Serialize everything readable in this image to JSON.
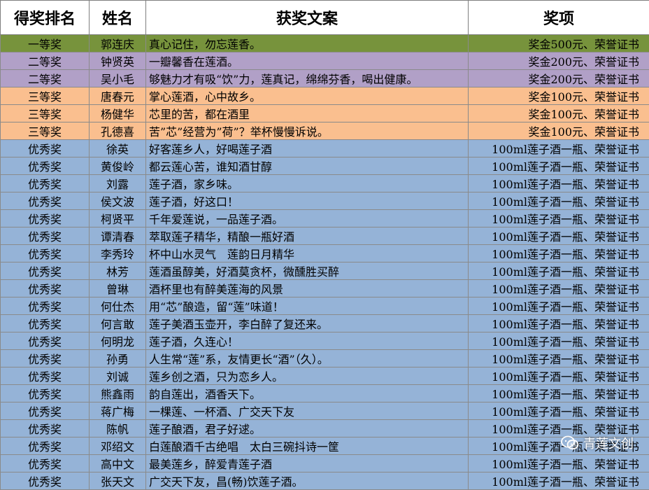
{
  "colors": {
    "first": "#77933c",
    "second": "#b1a0c7",
    "third": "#fabf8f",
    "merit": "#95b3d7"
  },
  "headers": [
    "得奖排名",
    "姓名",
    "获奖文案",
    "奖项"
  ],
  "rows": [
    {
      "tier": "first",
      "rank": "一等奖",
      "name": "郭连庆",
      "slogan": "真心记住，勿忘莲香。",
      "prize": "奖金500元、荣誉证书"
    },
    {
      "tier": "second",
      "rank": "二等奖",
      "name": "钟贤英",
      "slogan": "一瓣馨香在莲酒。",
      "prize": "奖金200元、荣誉证书"
    },
    {
      "tier": "second",
      "rank": "二等奖",
      "name": "吴小毛",
      "slogan": "够魅力才有吸“饮”力，莲真记，绵绵芬香，喝出健康。",
      "prize": "奖金200元、荣誉证书"
    },
    {
      "tier": "third",
      "rank": "三等奖",
      "name": "唐春元",
      "slogan": "掌心莲酒，心中故乡。",
      "prize": "奖金100元、荣誉证书"
    },
    {
      "tier": "third",
      "rank": "三等奖",
      "name": "杨健华",
      "slogan": "芯里的苦，都在酒里",
      "prize": "奖金100元、荣誉证书"
    },
    {
      "tier": "third",
      "rank": "三等奖",
      "name": "孔德喜",
      "slogan": "苦”芯”经营为”荷”？举杯慢慢诉说。",
      "prize": "奖金100元、荣誉证书"
    },
    {
      "tier": "merit",
      "rank": "优秀奖",
      "name": "徐英",
      "slogan": "好客莲乡人，好喝莲子酒",
      "prize": "100ml莲子酒一瓶、荣誉证书"
    },
    {
      "tier": "merit",
      "rank": "优秀奖",
      "name": "黄俊岭",
      "slogan": "都云莲心苦，谁知酒甘醇",
      "prize": "100ml莲子酒一瓶、荣誉证书"
    },
    {
      "tier": "merit",
      "rank": "优秀奖",
      "name": "刘露",
      "slogan": "莲子酒，家乡味。",
      "prize": "100ml莲子酒一瓶、荣誉证书"
    },
    {
      "tier": "merit",
      "rank": "优秀奖",
      "name": "侯文波",
      "slogan": "莲子酒，好这口！",
      "prize": "100ml莲子酒一瓶、荣誉证书"
    },
    {
      "tier": "merit",
      "rank": "优秀奖",
      "name": "柯贤平",
      "slogan": "千年爱莲说，一品莲子酒。",
      "prize": "100ml莲子酒一瓶、荣誉证书"
    },
    {
      "tier": "merit",
      "rank": "优秀奖",
      "name": "谭清春",
      "slogan": "萃取莲子精华，精酿一瓶好酒",
      "prize": "100ml莲子酒一瓶、荣誉证书"
    },
    {
      "tier": "merit",
      "rank": "优秀奖",
      "name": "李秀玲",
      "slogan": "杯中山水灵气　莲韵日月精华",
      "prize": "100ml莲子酒一瓶、荣誉证书"
    },
    {
      "tier": "merit",
      "rank": "优秀奖",
      "name": "林芳",
      "slogan": "莲酒虽醇美，好酒莫贪杯，微醺胜买醉",
      "prize": "100ml莲子酒一瓶、荣誉证书"
    },
    {
      "tier": "merit",
      "rank": "优秀奖",
      "name": "曾琳",
      "slogan": "酒杯里也有醉美莲海的风景",
      "prize": "100ml莲子酒一瓶、荣誉证书"
    },
    {
      "tier": "merit",
      "rank": "优秀奖",
      "name": "何仕杰",
      "slogan": "用“芯”酿造，留“莲”味道！",
      "prize": "100ml莲子酒一瓶、荣誉证书"
    },
    {
      "tier": "merit",
      "rank": "优秀奖",
      "name": "何言敢",
      "slogan": "莲子美酒玉壶开，李白醉了复还来。",
      "prize": "100ml莲子酒一瓶、荣誉证书"
    },
    {
      "tier": "merit",
      "rank": "优秀奖",
      "name": "何明龙",
      "slogan": "莲子酒，久连心！",
      "prize": "100ml莲子酒一瓶、荣誉证书"
    },
    {
      "tier": "merit",
      "rank": "优秀奖",
      "name": "孙勇",
      "slogan": "人生常“莲”系，友情更长“酒”（久）。",
      "prize": "100ml莲子酒一瓶、荣誉证书"
    },
    {
      "tier": "merit",
      "rank": "优秀奖",
      "name": "刘诚",
      "slogan": "莲乡创之酒，只为恋乡人。",
      "prize": "100ml莲子酒一瓶、荣誉证书"
    },
    {
      "tier": "merit",
      "rank": "优秀奖",
      "name": "熊鑫雨",
      "slogan": "韵自莲出，酒香天下。",
      "prize": "100ml莲子酒一瓶、荣誉证书"
    },
    {
      "tier": "merit",
      "rank": "优秀奖",
      "name": "蒋广梅",
      "slogan": "一棵莲、一杯酒、广交天下友",
      "prize": "100ml莲子酒一瓶、荣誉证书"
    },
    {
      "tier": "merit",
      "rank": "优秀奖",
      "name": "陈帆",
      "slogan": "莲子酿酒，君子好逑。",
      "prize": "100ml莲子酒一瓶、荣誉证书"
    },
    {
      "tier": "merit",
      "rank": "优秀奖",
      "name": "邓绍文",
      "slogan": "白莲酿酒千古绝唱　太白三碗抖诗一筐",
      "prize": "100ml莲子酒一瓶、荣誉证书"
    },
    {
      "tier": "merit",
      "rank": "优秀奖",
      "name": "高中文",
      "slogan": "最美莲乡，醉爱青莲子酒",
      "prize": "100ml莲子酒一瓶、荣誉证书"
    },
    {
      "tier": "merit",
      "rank": "优秀奖",
      "name": "张天文",
      "slogan": "广交天下友，昌(畅)饮莲子酒。",
      "prize": "100ml莲子酒一瓶、荣誉证书"
    }
  ],
  "watermark": {
    "icon": "wechat-icon",
    "text": "青莲文创"
  }
}
